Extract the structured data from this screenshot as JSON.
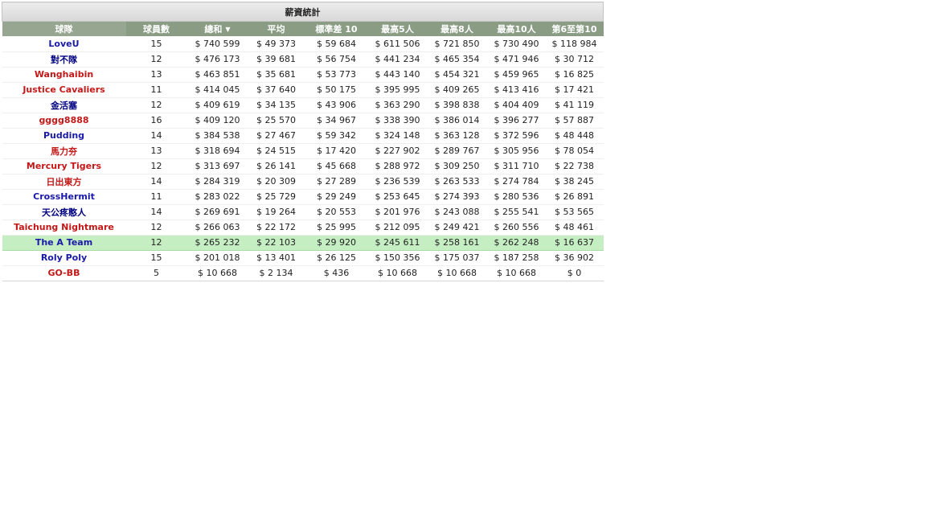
{
  "title": "薪資統計",
  "colors": {
    "team_blue": "#1a1aa8",
    "team_red": "#c41818",
    "team_navy": "#000080",
    "highlight": "#c6eec3",
    "header_bg": "#8a9d84"
  },
  "columns": [
    "球隊",
    "球員數",
    "總和",
    "平均",
    "標準差 10",
    "最高5人",
    "最高8人",
    "最高10人",
    "第6至第10"
  ],
  "sort_icon": "triangle-down-icon",
  "sort_glyph": "▼",
  "rows": [
    {
      "team": "LoveU",
      "color": "#1a1aa8",
      "highlight": false,
      "cells": [
        "15",
        "$ 740 599",
        "$ 49 373",
        "$ 59 684",
        "$ 611 506",
        "$ 721 850",
        "$ 730 490",
        "$ 118 984"
      ]
    },
    {
      "team": "對不隊",
      "color": "#000080",
      "highlight": false,
      "cells": [
        "12",
        "$ 476 173",
        "$ 39 681",
        "$ 56 754",
        "$ 441 234",
        "$ 465 354",
        "$ 471 946",
        "$ 30 712"
      ]
    },
    {
      "team": "Wanghaibin",
      "color": "#c41818",
      "highlight": false,
      "cells": [
        "13",
        "$ 463 851",
        "$ 35 681",
        "$ 53 773",
        "$ 443 140",
        "$ 454 321",
        "$ 459 965",
        "$ 16 825"
      ]
    },
    {
      "team": "Justice Cavaliers",
      "color": "#c41818",
      "highlight": false,
      "cells": [
        "11",
        "$ 414 045",
        "$ 37 640",
        "$ 50 175",
        "$ 395 995",
        "$ 409 265",
        "$ 413 416",
        "$ 17 421"
      ]
    },
    {
      "team": "金活塞",
      "color": "#000080",
      "highlight": false,
      "cells": [
        "12",
        "$ 409 619",
        "$ 34 135",
        "$ 43 906",
        "$ 363 290",
        "$ 398 838",
        "$ 404 409",
        "$ 41 119"
      ]
    },
    {
      "team": "gggg8888",
      "color": "#c41818",
      "highlight": false,
      "cells": [
        "16",
        "$ 409 120",
        "$ 25 570",
        "$ 34 967",
        "$ 338 390",
        "$ 386 014",
        "$ 396 277",
        "$ 57 887"
      ]
    },
    {
      "team": "Pudding",
      "color": "#1a1aa8",
      "highlight": false,
      "cells": [
        "14",
        "$ 384 538",
        "$ 27 467",
        "$ 59 342",
        "$ 324 148",
        "$ 363 128",
        "$ 372 596",
        "$ 48 448"
      ]
    },
    {
      "team": "馬力夯",
      "color": "#c41818",
      "highlight": false,
      "cells": [
        "13",
        "$ 318 694",
        "$ 24 515",
        "$ 17 420",
        "$ 227 902",
        "$ 289 767",
        "$ 305 956",
        "$ 78 054"
      ]
    },
    {
      "team": "Mercury Tigers",
      "color": "#c41818",
      "highlight": false,
      "cells": [
        "12",
        "$ 313 697",
        "$ 26 141",
        "$ 45 668",
        "$ 288 972",
        "$ 309 250",
        "$ 311 710",
        "$ 22 738"
      ]
    },
    {
      "team": "日出東方",
      "color": "#c41818",
      "highlight": false,
      "cells": [
        "14",
        "$ 284 319",
        "$ 20 309",
        "$ 27 289",
        "$ 236 539",
        "$ 263 533",
        "$ 274 784",
        "$ 38 245"
      ]
    },
    {
      "team": "CrossHermit",
      "color": "#1a1aa8",
      "highlight": false,
      "cells": [
        "11",
        "$ 283 022",
        "$ 25 729",
        "$ 29 249",
        "$ 253 645",
        "$ 274 393",
        "$ 280 536",
        "$ 26 891"
      ]
    },
    {
      "team": "天公疼憨人",
      "color": "#000080",
      "highlight": false,
      "cells": [
        "14",
        "$ 269 691",
        "$ 19 264",
        "$ 20 553",
        "$ 201 976",
        "$ 243 088",
        "$ 255 541",
        "$ 53 565"
      ]
    },
    {
      "team": "Taichung Nightmare",
      "color": "#c41818",
      "highlight": false,
      "cells": [
        "12",
        "$ 266 063",
        "$ 22 172",
        "$ 25 995",
        "$ 212 095",
        "$ 249 421",
        "$ 260 556",
        "$ 48 461"
      ]
    },
    {
      "team": "The A Team",
      "color": "#1a1aa8",
      "highlight": true,
      "cells": [
        "12",
        "$ 265 232",
        "$ 22 103",
        "$ 29 920",
        "$ 245 611",
        "$ 258 161",
        "$ 262 248",
        "$ 16 637"
      ]
    },
    {
      "team": "Roly Poly",
      "color": "#1a1aa8",
      "highlight": false,
      "cells": [
        "15",
        "$ 201 018",
        "$ 13 401",
        "$ 26 125",
        "$ 150 356",
        "$ 175 037",
        "$ 187 258",
        "$ 36 902"
      ]
    },
    {
      "team": "GO-BB",
      "color": "#c41818",
      "highlight": false,
      "cells": [
        "5",
        "$ 10 668",
        "$ 2 134",
        "$ 436",
        "$ 10 668",
        "$ 10 668",
        "$ 10 668",
        "$ 0"
      ]
    }
  ]
}
